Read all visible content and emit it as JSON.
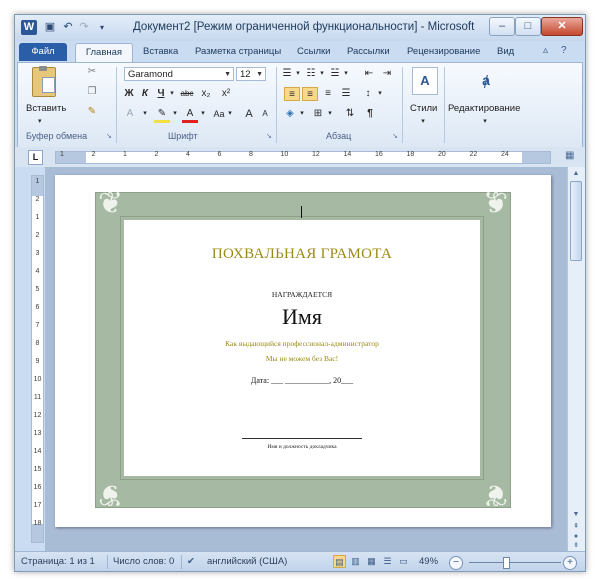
{
  "window": {
    "title": "Документ2 [Режим ограниченной функциональности] - Microsoft",
    "logo": "W",
    "qat_icons": [
      "save-icon",
      "undo-icon",
      "redo-icon",
      "customize-qat-icon"
    ],
    "controls": {
      "minimize": "–",
      "maximize": "□",
      "close": "✕"
    }
  },
  "ribbon_tabs": [
    {
      "label": "Файл"
    },
    {
      "label": "Главная"
    },
    {
      "label": "Вставка"
    },
    {
      "label": "Разметка страницы"
    },
    {
      "label": "Ссылки"
    },
    {
      "label": "Рассылки"
    },
    {
      "label": "Рецензирование"
    },
    {
      "label": "Вид"
    }
  ],
  "ribbon": {
    "clipboard": {
      "paste_label": "Вставить",
      "group_label": "Буфер обмена"
    },
    "font": {
      "font_name": "Garamond",
      "font_size": "12",
      "group_label": "Шрифт",
      "buttons": {
        "bold": "Ж",
        "italic": "К",
        "underline": "Ч",
        "strike": "abc",
        "subscript": "x₂",
        "superscript": "x²",
        "grow": "A",
        "shrink": "A",
        "case": "Aa"
      }
    },
    "paragraph": {
      "group_label": "Абзац",
      "pilcrow": "¶"
    },
    "styles": {
      "label": "Стили"
    },
    "editing": {
      "label": "Редактирование"
    }
  },
  "ruler": {
    "tab_selector": "L",
    "ticks": [
      "1",
      "2",
      "1",
      "2",
      "4",
      "6",
      "8",
      "10",
      "12",
      "14",
      "16",
      "18",
      "20",
      "22",
      "24"
    ],
    "vticks": [
      "1",
      "2",
      "1",
      "2",
      "3",
      "4",
      "5",
      "6",
      "7",
      "8",
      "9",
      "10",
      "11",
      "12",
      "13",
      "14",
      "15",
      "16",
      "17",
      "18"
    ]
  },
  "certificate": {
    "title": "ПОХВАЛЬНАЯ ГРАМОТА",
    "awarded": "НАГРАЖДАЕТСЯ",
    "name": "Имя",
    "line1": "Как выдающийся профессионал-администратор",
    "line2": "Мы не можем без Вас!",
    "date_label": "Дата:",
    "date_blanks": "___  ___________,  20___",
    "signature_caption": "Имя и должность докладчика"
  },
  "status_bar": {
    "page": "Страница: 1 из 1",
    "words": "Число слов: 0",
    "language": "английский (США)",
    "zoom": "49%",
    "zoom_level": 0.49
  }
}
